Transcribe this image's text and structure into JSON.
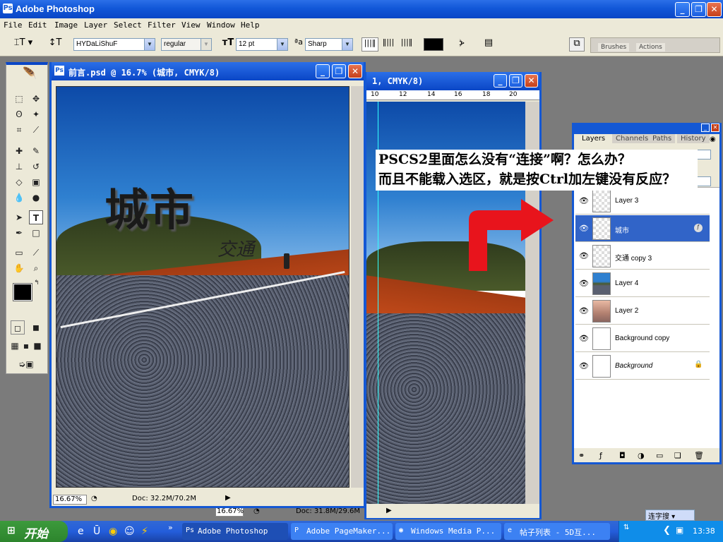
{
  "app": {
    "title": "Adobe Photoshop"
  },
  "menu": [
    "File",
    "Edit",
    "Image",
    "Layer",
    "Select",
    "Filter",
    "View",
    "Window",
    "Help"
  ],
  "options": {
    "font_family": "HYDaLiShuF",
    "font_style": "regular",
    "font_size": "12 pt",
    "anti_alias": "Sharp",
    "palette_tabs": [
      "Brushes",
      "Actions"
    ]
  },
  "doc_front": {
    "title": "前言.psd @ 16.7% (城市, CMYK/8)",
    "zoom": "16.67%",
    "doc_info": "Doc: 32.2M/70.2M",
    "headline": "城市",
    "subline": "交通"
  },
  "doc_back": {
    "title": "1, CMYK/8)",
    "zoom": "16.67%",
    "doc_info": "Doc: 31.8M/29.6M",
    "ruler": [
      "10",
      "12",
      "14",
      "16",
      "18",
      "20"
    ]
  },
  "layers_panel": {
    "tabs": [
      "Layers",
      "Channels",
      "Paths",
      "History"
    ],
    "layers": [
      {
        "name": "Layer 3",
        "selected": false,
        "locked": false
      },
      {
        "name": "城市",
        "selected": true,
        "locked": false
      },
      {
        "name": "交通 copy 3",
        "selected": false,
        "locked": false
      },
      {
        "name": "Layer 4",
        "selected": false,
        "locked": false
      },
      {
        "name": "Layer 2",
        "selected": false,
        "locked": false
      },
      {
        "name": "Background copy",
        "selected": false,
        "locked": false
      },
      {
        "name": "Background",
        "selected": false,
        "locked": true
      }
    ]
  },
  "annotation": {
    "line1": "PSCS2里面怎么没有“连接”啊？怎么办？",
    "line2": "而且不能载入选区，就是按Ctrl加左键没有反应？"
  },
  "taskbar": {
    "start_label": "开始",
    "tasks": [
      "Adobe Photoshop",
      "Adobe PageMaker...",
      "Windows Media P...",
      "帖子列表 - 5D互..."
    ],
    "clock": "13:38",
    "ime": "连字搜"
  },
  "colors": {
    "xp_blue": "#0a46c6",
    "arrow_red": "#e8141c",
    "layer_selected": "#3164c8"
  }
}
